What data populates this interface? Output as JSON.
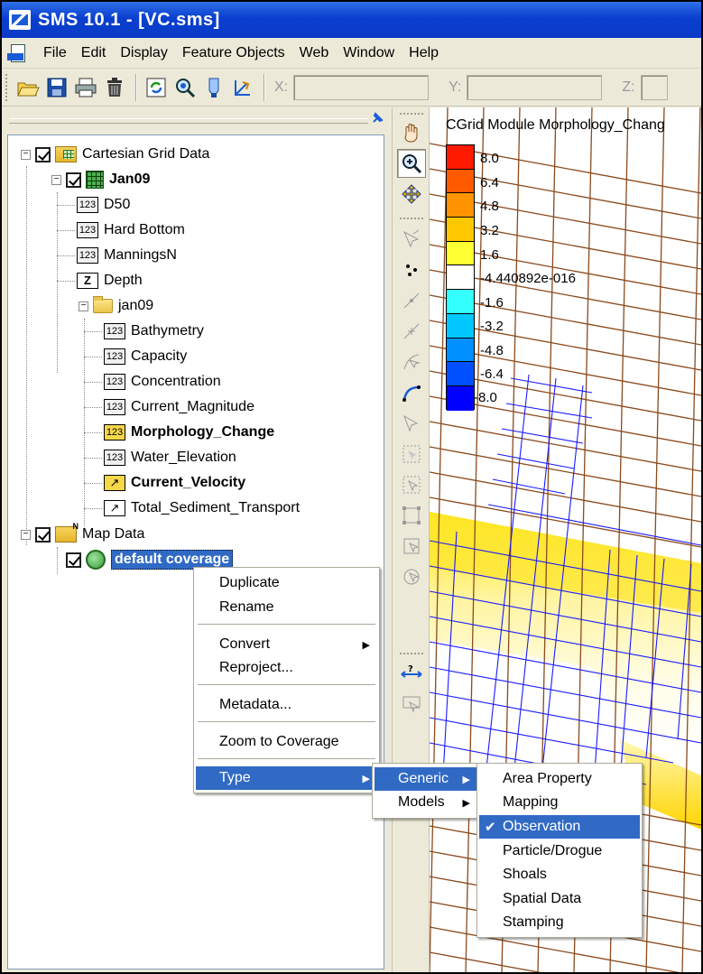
{
  "window": {
    "title": "SMS 10.1 - [VC.sms]"
  },
  "menubar": [
    "File",
    "Edit",
    "Display",
    "Feature Objects",
    "Web",
    "Window",
    "Help"
  ],
  "toolbar": {
    "buttons": [
      "open-icon",
      "save-icon",
      "print-icon",
      "delete-icon",
      "refresh-icon",
      "zoom-frame-icon",
      "model-check-icon",
      "projection-icon"
    ],
    "x_label": "X:",
    "y_label": "Y:",
    "z_label": "Z:",
    "x_value": "",
    "y_value": "",
    "z_value": ""
  },
  "tree": {
    "cartesian_grid_data": "Cartesian Grid Data",
    "jan09_grid": "Jan09",
    "d50": "D50",
    "hard_bottom": "Hard Bottom",
    "manningsn": "ManningsN",
    "depth": "Depth",
    "jan09_folder": "jan09",
    "bathymetry": "Bathymetry",
    "capacity": "Capacity",
    "concentration": "Concentration",
    "current_magnitude": "Current_Magnitude",
    "morphology_change": "Morphology_Change",
    "water_elevation": "Water_Elevation",
    "current_velocity": "Current_Velocity",
    "total_sediment_transport": "Total_Sediment_Transport",
    "map_data": "Map Data",
    "default_coverage": "default coverage",
    "icon_123": "123",
    "icon_z": "Z",
    "icon_vec": "↗"
  },
  "context_menu": {
    "duplicate": "Duplicate",
    "rename": "Rename",
    "convert": "Convert",
    "reproject": "Reproject...",
    "metadata": "Metadata...",
    "zoom_to_coverage": "Zoom to Coverage",
    "type": "Type"
  },
  "type_submenu": {
    "generic": "Generic",
    "models": "Models"
  },
  "generic_submenu": {
    "area_property": "Area Property",
    "mapping": "Mapping",
    "observation": "Observation",
    "particle_drogue": "Particle/Drogue",
    "shoals": "Shoals",
    "spatial_data": "Spatial Data",
    "stamping": "Stamping",
    "checked_item": "Observation"
  },
  "map": {
    "title": "CGrid Module Morphology_Chang",
    "legend_labels": [
      "8.0",
      "6.4",
      "4.8",
      "3.2",
      "1.6",
      "-4.440892e-016",
      "-1.6",
      "-3.2",
      "-4.8",
      "-6.4",
      "-8.0"
    ],
    "legend_colors": [
      "#ff1a00",
      "#ff5a00",
      "#ff9400",
      "#ffc800",
      "#ffff33",
      "#ffffff",
      "#33ffff",
      "#00c8ff",
      "#0090ff",
      "#0050ff",
      "#0000ff"
    ]
  },
  "colors": {
    "selection": "#316ac5",
    "title_bar": "#0a3fcf",
    "grid_brown": "#8b4a1c",
    "grid_blue": "#1a1aff"
  }
}
